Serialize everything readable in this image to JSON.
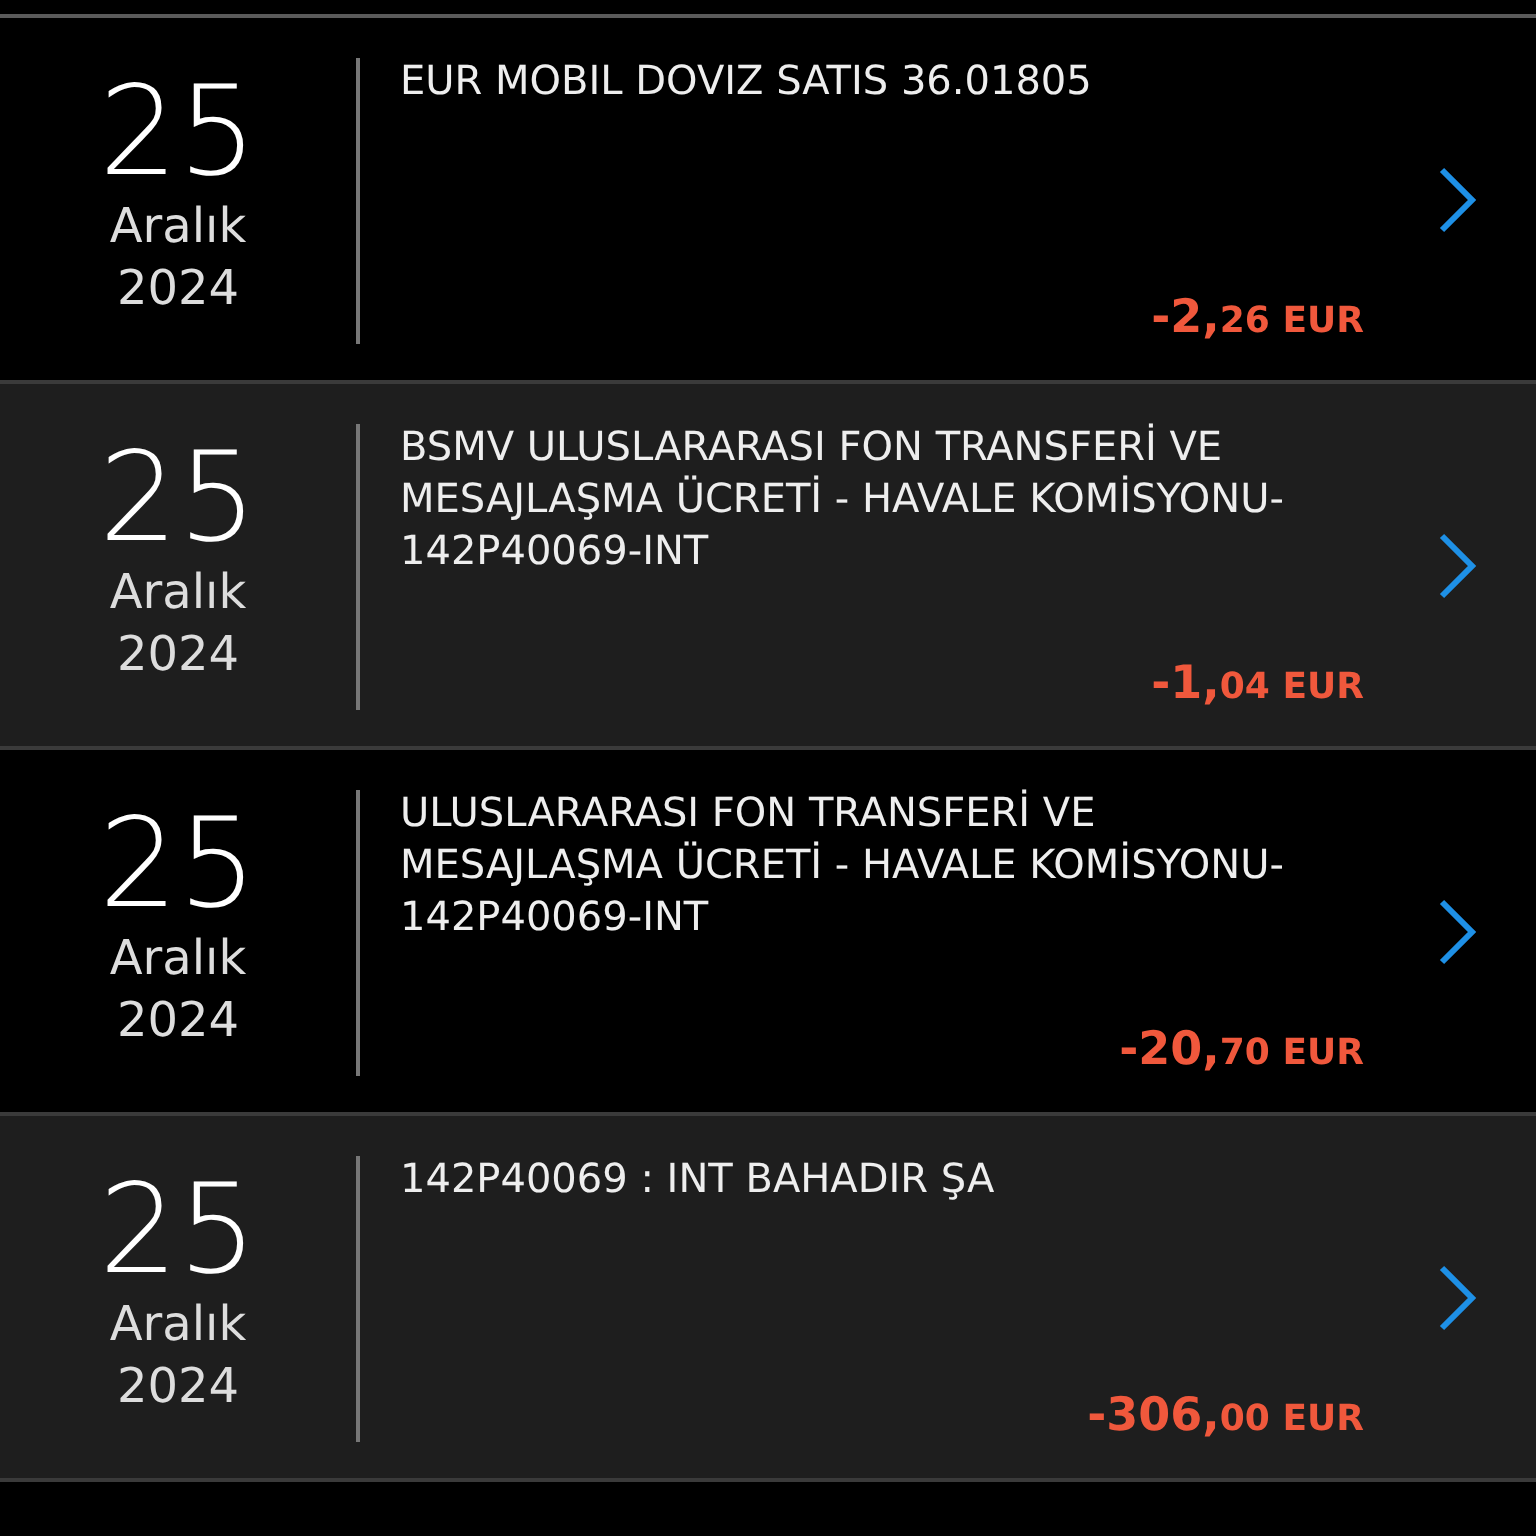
{
  "transactions": [
    {
      "day": "25",
      "month": "Aralık",
      "year": "2024",
      "description": "EUR MOBIL DOVIZ SATIS 36.01805",
      "amount_whole": "-2,",
      "amount_fraction": "26 EUR"
    },
    {
      "day": "25",
      "month": "Aralık",
      "year": "2024",
      "description": "BSMV ULUSLARARASI FON TRANSFERİ VE MESAJLAŞMA ÜCRETİ - HAVALE KOMİSYONU-142P40069-INT",
      "amount_whole": "-1,",
      "amount_fraction": "04 EUR"
    },
    {
      "day": "25",
      "month": "Aralık",
      "year": "2024",
      "description": "ULUSLARARASI FON TRANSFERİ VE MESAJLAŞMA ÜCRETİ - HAVALE KOMİSYONU-142P40069-INT",
      "amount_whole": "-20,",
      "amount_fraction": "70 EUR"
    },
    {
      "day": "25",
      "month": "Aralık",
      "year": "2024",
      "description": "142P40069 : INT BAHADIR ŞA",
      "amount_whole": "-306,",
      "amount_fraction": "00 EUR"
    }
  ]
}
